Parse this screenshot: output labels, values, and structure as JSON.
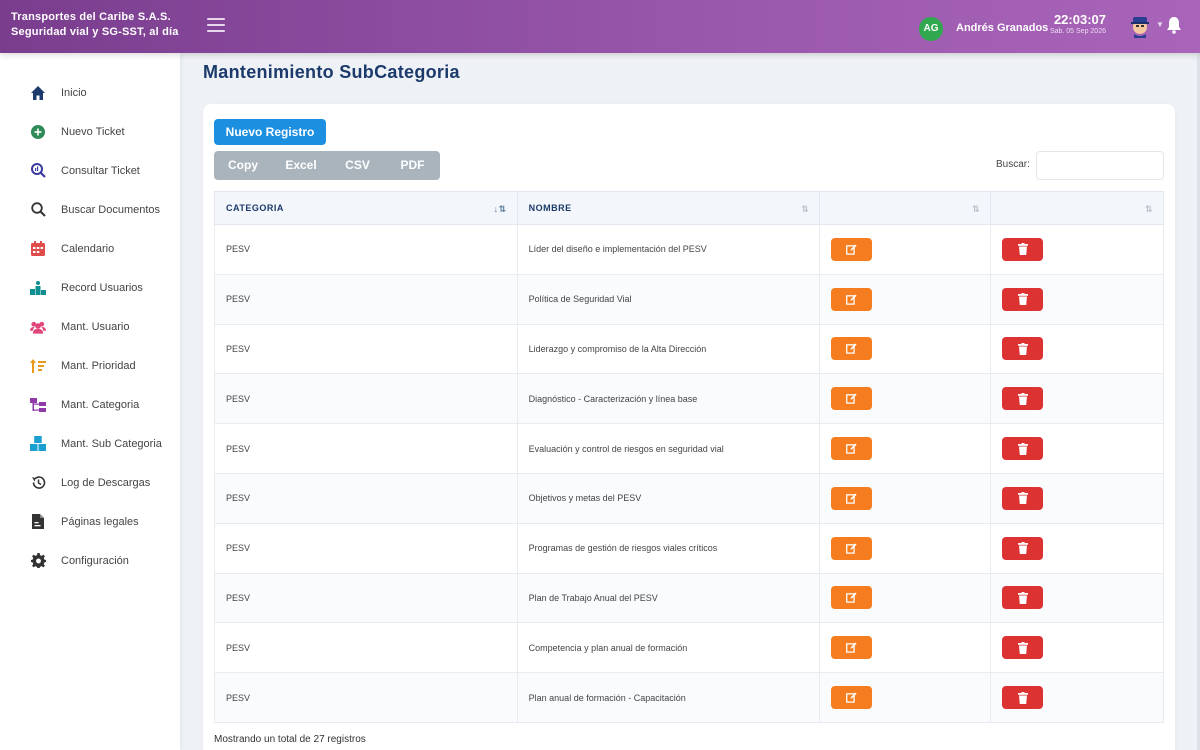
{
  "header": {
    "company_line1": "Transportes del Caribe S.A.S.",
    "company_line2": "Seguridad vial y SG-SST, al día",
    "user_initials": "AG",
    "user_name": "Andrés Granados",
    "time": "22:03:07",
    "date": "Sab. 05 Sep 2026",
    "colors": {
      "bar_start": "#7a3d8e",
      "bar_end": "#a864b8",
      "initials_badge": "#2fa84f"
    }
  },
  "sidebar": {
    "items": [
      {
        "label": "Inicio",
        "icon": "home-icon",
        "color": "#1c3a6b"
      },
      {
        "label": "Nuevo Ticket",
        "icon": "plus-circle-icon",
        "color": "#2e8b57"
      },
      {
        "label": "Consultar Ticket",
        "icon": "search-chart-icon",
        "color": "#3a3aa0"
      },
      {
        "label": "Buscar Documentos",
        "icon": "magnifier-icon",
        "color": "#333333"
      },
      {
        "label": "Calendario",
        "icon": "calendar-icon",
        "color": "#e04b4b"
      },
      {
        "label": "Record Usuarios",
        "icon": "podium-icon",
        "color": "#0f8f8f"
      },
      {
        "label": "Mant. Usuario",
        "icon": "users-icon",
        "color": "#e0457b"
      },
      {
        "label": "Mant. Prioridad",
        "icon": "sort-priority-icon",
        "color": "#e89a1f"
      },
      {
        "label": "Mant. Categoria",
        "icon": "category-tree-icon",
        "color": "#8e3aa8"
      },
      {
        "label": "Mant. Sub Categoria",
        "icon": "boxes-icon",
        "color": "#1a9fd0"
      },
      {
        "label": "Log de Descargas",
        "icon": "history-icon",
        "color": "#333333"
      },
      {
        "label": "Páginas legales",
        "icon": "document-icon",
        "color": "#333333"
      },
      {
        "label": "Configuración",
        "icon": "gear-icon",
        "color": "#333333"
      }
    ]
  },
  "main": {
    "title": "Mantenimiento SubCategoria",
    "new_button": "Nuevo Registro",
    "export_buttons": [
      "Copy",
      "Excel",
      "CSV",
      "PDF"
    ],
    "search_label": "Buscar:",
    "search_value": "",
    "columns": [
      "CATEGORIA",
      "NOMBRE",
      "",
      ""
    ],
    "rows": [
      {
        "categoria": "PESV",
        "nombre": "Líder del diseño e implementación del PESV"
      },
      {
        "categoria": "PESV",
        "nombre": "Política de Seguridad Vial"
      },
      {
        "categoria": "PESV",
        "nombre": "Liderazgo y compromiso de la Alta Dirección"
      },
      {
        "categoria": "PESV",
        "nombre": "Diagnóstico - Caracterización y línea base"
      },
      {
        "categoria": "PESV",
        "nombre": "Evaluación y control de riesgos en seguridad vial"
      },
      {
        "categoria": "PESV",
        "nombre": "Objetivos y metas del PESV"
      },
      {
        "categoria": "PESV",
        "nombre": "Programas de gestión de riesgos viales críticos"
      },
      {
        "categoria": "PESV",
        "nombre": "Plan de Trabajo Anual del PESV"
      },
      {
        "categoria": "PESV",
        "nombre": "Competencia y plan anual de formación"
      },
      {
        "categoria": "PESV",
        "nombre": "Plan anual de formación - Capacitación"
      }
    ],
    "footer": "Mostrando un total de 27 registros",
    "colors": {
      "primary": "#1d8fe0",
      "edit": "#f57c1f",
      "delete": "#dc3232",
      "title": "#1c3a6b"
    }
  }
}
